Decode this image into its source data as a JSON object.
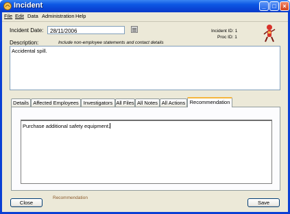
{
  "window": {
    "title": "Incident"
  },
  "menu": [
    {
      "label": "File",
      "key": "F"
    },
    {
      "label": "Edit",
      "key": "E"
    },
    {
      "label": "Data",
      "key": ""
    },
    {
      "label": "Administration",
      "key": ""
    },
    {
      "label": "Help",
      "key": ""
    }
  ],
  "form": {
    "date_label": "Incident Date:",
    "date_value": "28/11/2006",
    "incident_id_label": "Incident ID:",
    "incident_id_value": "1",
    "proc_id_label": "Proc ID:",
    "proc_id_value": "1",
    "description_label": "Description:",
    "description_hint": "Include non-employee statements and contact details",
    "description_value": "Accidental spill."
  },
  "tabs": [
    "Details",
    "Affected Employees",
    "Investigators",
    "All Files",
    "All Notes",
    "All Actions",
    "Recommendation"
  ],
  "active_tab": "Recommendation",
  "recommendation": {
    "text": "Purchase additional safety equipment."
  },
  "buttons": {
    "close": "Close",
    "save": "Save"
  },
  "status": {
    "text": "Recommendation"
  },
  "icons": {
    "app": "incident-app-icon",
    "calendar": "calendar-icon",
    "logo": "mascot-logo-icon",
    "minimize": "minimize-icon",
    "maximize": "maximize-icon",
    "close": "close-icon"
  },
  "colors": {
    "titlebar": "#0d58e4",
    "client_bg": "#ece9d8",
    "active_tab_accent": "#f5b53c",
    "status_text": "#8b5a2b"
  }
}
